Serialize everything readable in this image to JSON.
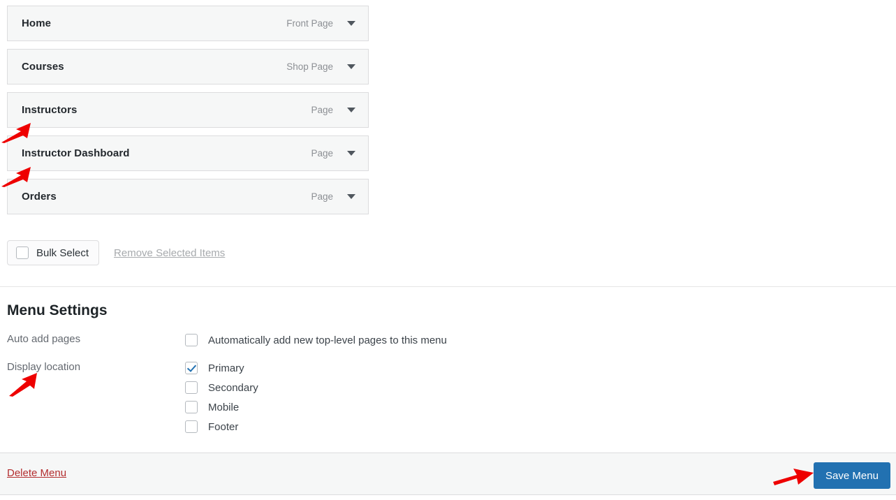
{
  "menu_items": [
    {
      "title": "Home",
      "type": "Front Page",
      "toggle_icon": "chevron-down-icon"
    },
    {
      "title": "Courses",
      "type": "Shop Page",
      "toggle_icon": "chevron-down-icon"
    },
    {
      "title": "Instructors",
      "type": "Page",
      "toggle_icon": "chevron-down-icon"
    },
    {
      "title": "Instructor Dashboard",
      "type": "Page",
      "toggle_icon": "chevron-down-icon"
    },
    {
      "title": "Orders",
      "type": "Page",
      "toggle_icon": "chevron-down-icon"
    }
  ],
  "bulk": {
    "select_label": "Bulk Select",
    "select_checked": false,
    "remove_label": "Remove Selected Items"
  },
  "settings": {
    "heading": "Menu Settings",
    "auto_add": {
      "label": "Auto add pages",
      "option_label": "Automatically add new top-level pages to this menu",
      "checked": false
    },
    "display_location": {
      "label": "Display location",
      "options": [
        {
          "label": "Primary",
          "checked": true
        },
        {
          "label": "Secondary",
          "checked": false
        },
        {
          "label": "Mobile",
          "checked": false
        },
        {
          "label": "Footer",
          "checked": false
        }
      ]
    }
  },
  "footer": {
    "delete_label": "Delete Menu",
    "save_label": "Save Menu"
  },
  "annotations": {
    "arrow_color": "#ee0000",
    "arrows": [
      {
        "name": "arrow-instructors"
      },
      {
        "name": "arrow-instructor-dashboard"
      },
      {
        "name": "arrow-display-location"
      },
      {
        "name": "arrow-save-menu"
      }
    ]
  },
  "colors": {
    "accent_blue": "#2271b1",
    "delete_red": "#b32d2e",
    "row_background": "#f6f7f7",
    "row_border": "#dcdcde",
    "muted_text": "#8c8f94"
  }
}
